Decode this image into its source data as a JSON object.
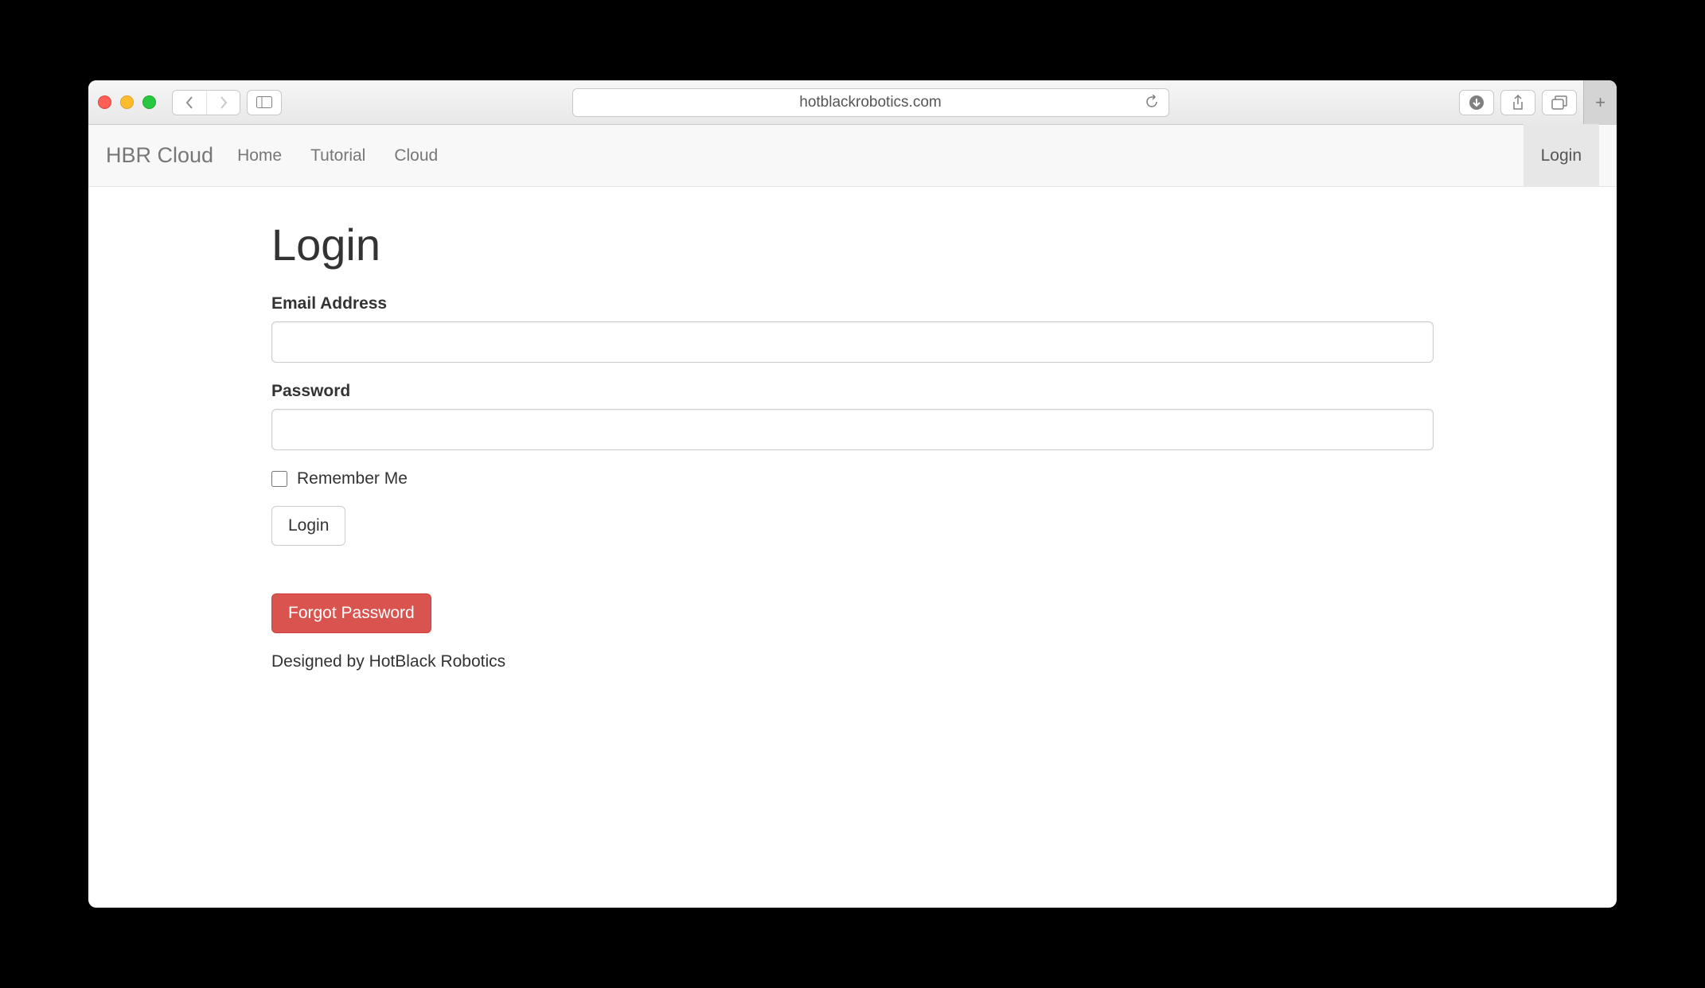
{
  "browser": {
    "address": "hotblackrobotics.com"
  },
  "navbar": {
    "brand": "HBR Cloud",
    "links": [
      "Home",
      "Tutorial",
      "Cloud"
    ],
    "login": "Login"
  },
  "page": {
    "title": "Login",
    "email_label": "Email Address",
    "email_value": "",
    "password_label": "Password",
    "password_value": "",
    "remember_label": "Remember Me",
    "login_button": "Login",
    "forgot_button": "Forgot Password",
    "footer": "Designed by HotBlack Robotics"
  }
}
